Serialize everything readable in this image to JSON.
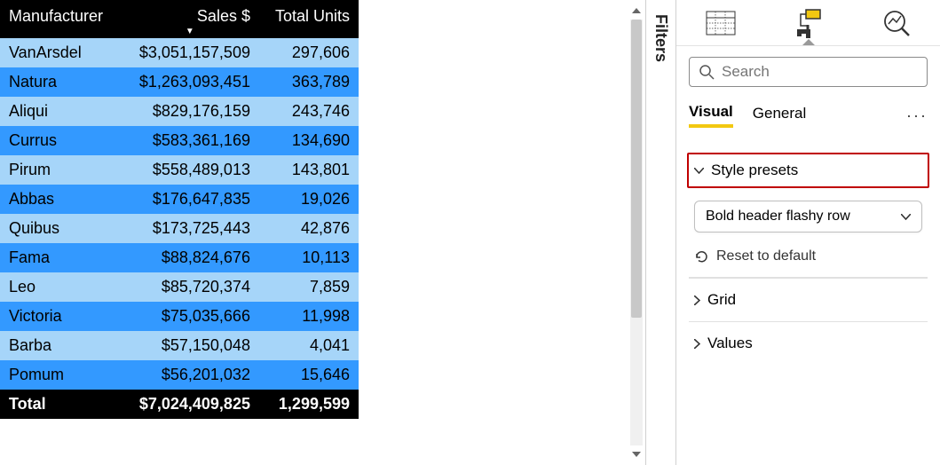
{
  "table": {
    "columns": [
      "Manufacturer",
      "Sales $",
      "Total Units"
    ],
    "sort_column_index": 1,
    "rows": [
      {
        "manufacturer": "VanArsdel",
        "sales": "$3,051,157,509",
        "units": "297,606"
      },
      {
        "manufacturer": "Natura",
        "sales": "$1,263,093,451",
        "units": "363,789"
      },
      {
        "manufacturer": "Aliqui",
        "sales": "$829,176,159",
        "units": "243,746"
      },
      {
        "manufacturer": "Currus",
        "sales": "$583,361,169",
        "units": "134,690"
      },
      {
        "manufacturer": "Pirum",
        "sales": "$558,489,013",
        "units": "143,801"
      },
      {
        "manufacturer": "Abbas",
        "sales": "$176,647,835",
        "units": "19,026"
      },
      {
        "manufacturer": "Quibus",
        "sales": "$173,725,443",
        "units": "42,876"
      },
      {
        "manufacturer": "Fama",
        "sales": "$88,824,676",
        "units": "10,113"
      },
      {
        "manufacturer": "Leo",
        "sales": "$85,720,374",
        "units": "7,859"
      },
      {
        "manufacturer": "Victoria",
        "sales": "$75,035,666",
        "units": "11,998"
      },
      {
        "manufacturer": "Barba",
        "sales": "$57,150,048",
        "units": "4,041"
      },
      {
        "manufacturer": "Pomum",
        "sales": "$56,201,032",
        "units": "15,646"
      }
    ],
    "totals": {
      "label": "Total",
      "sales": "$7,024,409,825",
      "units": "1,299,599"
    }
  },
  "filters_label": "Filters",
  "format_pane": {
    "search_placeholder": "Search",
    "tabs": {
      "visual": "Visual",
      "general": "General"
    },
    "style_presets_label": "Style presets",
    "style_dropdown_value": "Bold header flashy row",
    "reset_label": "Reset to default",
    "grid_label": "Grid",
    "values_label": "Values"
  }
}
